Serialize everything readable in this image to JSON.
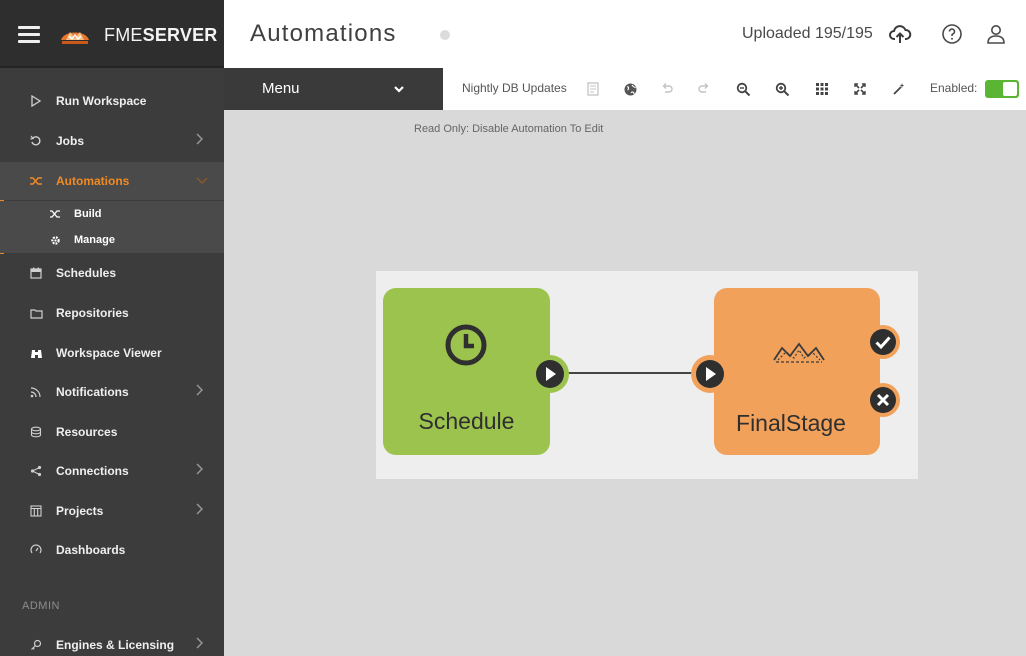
{
  "brand": {
    "name_light": "FME",
    "name_bold": "SERVER"
  },
  "sidebar": {
    "items": [
      {
        "label": "Run Workspace",
        "icon": "play-outline-icon"
      },
      {
        "label": "Jobs",
        "icon": "history-icon"
      },
      {
        "label": "Automations",
        "icon": "shuffle-icon"
      },
      {
        "label": "Schedules",
        "icon": "calendar-icon"
      },
      {
        "label": "Repositories",
        "icon": "folder-icon"
      },
      {
        "label": "Workspace Viewer",
        "icon": "binoculars-icon"
      },
      {
        "label": "Notifications",
        "icon": "rss-icon"
      },
      {
        "label": "Resources",
        "icon": "database-icon"
      },
      {
        "label": "Connections",
        "icon": "share-icon"
      },
      {
        "label": "Projects",
        "icon": "columns-icon"
      },
      {
        "label": "Dashboards",
        "icon": "gauge-icon"
      },
      {
        "label": "Engines & Licensing",
        "icon": "key-icon"
      }
    ],
    "subitems": [
      {
        "label": "Build",
        "icon": "shuffle-icon"
      },
      {
        "label": "Manage",
        "icon": "gear-icon"
      }
    ],
    "section_admin": "ADMIN"
  },
  "header": {
    "title": "Automations",
    "upload_status": "Uploaded 195/195"
  },
  "toolbar": {
    "menu_label": "Menu",
    "automation_name": "Nightly DB Updates",
    "enabled_label": "Enabled:",
    "enabled": true
  },
  "canvas": {
    "readonly_message": "Read Only: Disable Automation To Edit"
  },
  "workflow": {
    "nodes": [
      {
        "label": "Schedule",
        "color": "#9bc34d",
        "icon": "clock-icon"
      },
      {
        "label": "FinalStage",
        "color": "#f1a15a",
        "icon": "fme-workspace-icon"
      }
    ]
  },
  "colors": {
    "accent": "#f08a24",
    "toggle_on": "#5bb534",
    "sidebar_bg": "#3c3c3c",
    "canvas_bg": "#d9d9d9"
  }
}
